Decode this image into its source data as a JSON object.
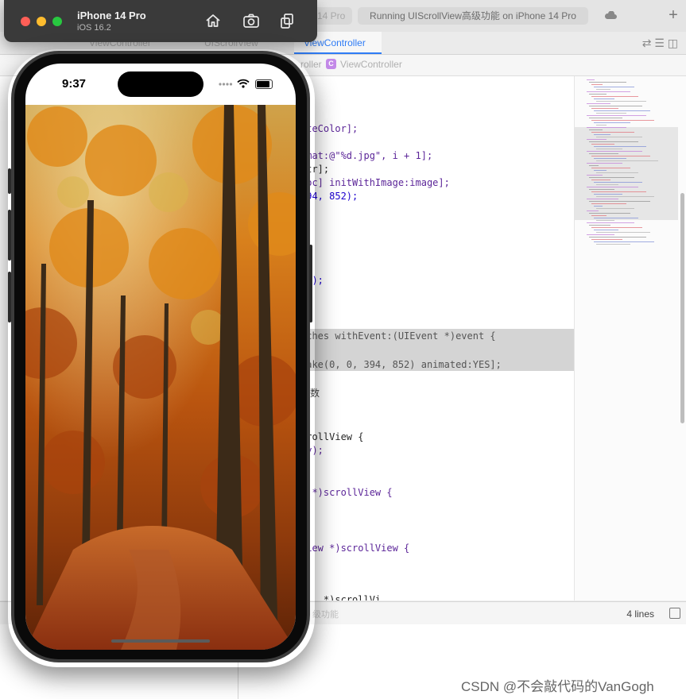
{
  "xcode": {
    "tab_partial": "14 Pro",
    "status": "Running UIScrollView高级功能 on iPhone 14 Pro",
    "tabs": [
      "ViewController",
      "UIScrollView",
      "ViewController"
    ],
    "jumpbar": [
      "roller",
      "ViewController"
    ],
    "code_lines": [
      {
        "text": "iteColor];"
      },
      {
        "text": "rmat:@\"%d.jpg\", i + 1];"
      },
      {
        "text": "str];"
      },
      {
        "text": "loc] initWithImage:image];"
      },
      {
        "text": "394, 852);"
      },
      {
        "text": " 0);"
      },
      {
        "text": "uches withEvent:(UIEvent *)event {"
      },
      {
        "text": "Make(0, 0, 394, 852) animated:YES];"
      },
      {
        "text": "函数"
      },
      {
        "text": "crollView {"
      },
      {
        "text": ".y);"
      },
      {
        "text": "w *)scrollView {"
      },
      {
        "text": "View *)scrollView {"
      },
      {
        "text": "    *)scrollVi"
      }
    ],
    "debug_text": "级功能",
    "lines_count": "4 lines",
    "watermark": "CSDN @不会敲代码的VanGogh"
  },
  "simulator": {
    "device_name": "iPhone 14 Pro",
    "os_version": "iOS 16.2",
    "tools": [
      "home-icon",
      "screenshot-icon",
      "rotate-icon"
    ],
    "time": "9:37"
  },
  "colors": {
    "accent": "#2f7cf6",
    "traffic_red": "#ff5f57",
    "traffic_yellow": "#febc2e",
    "traffic_green": "#28c840"
  }
}
